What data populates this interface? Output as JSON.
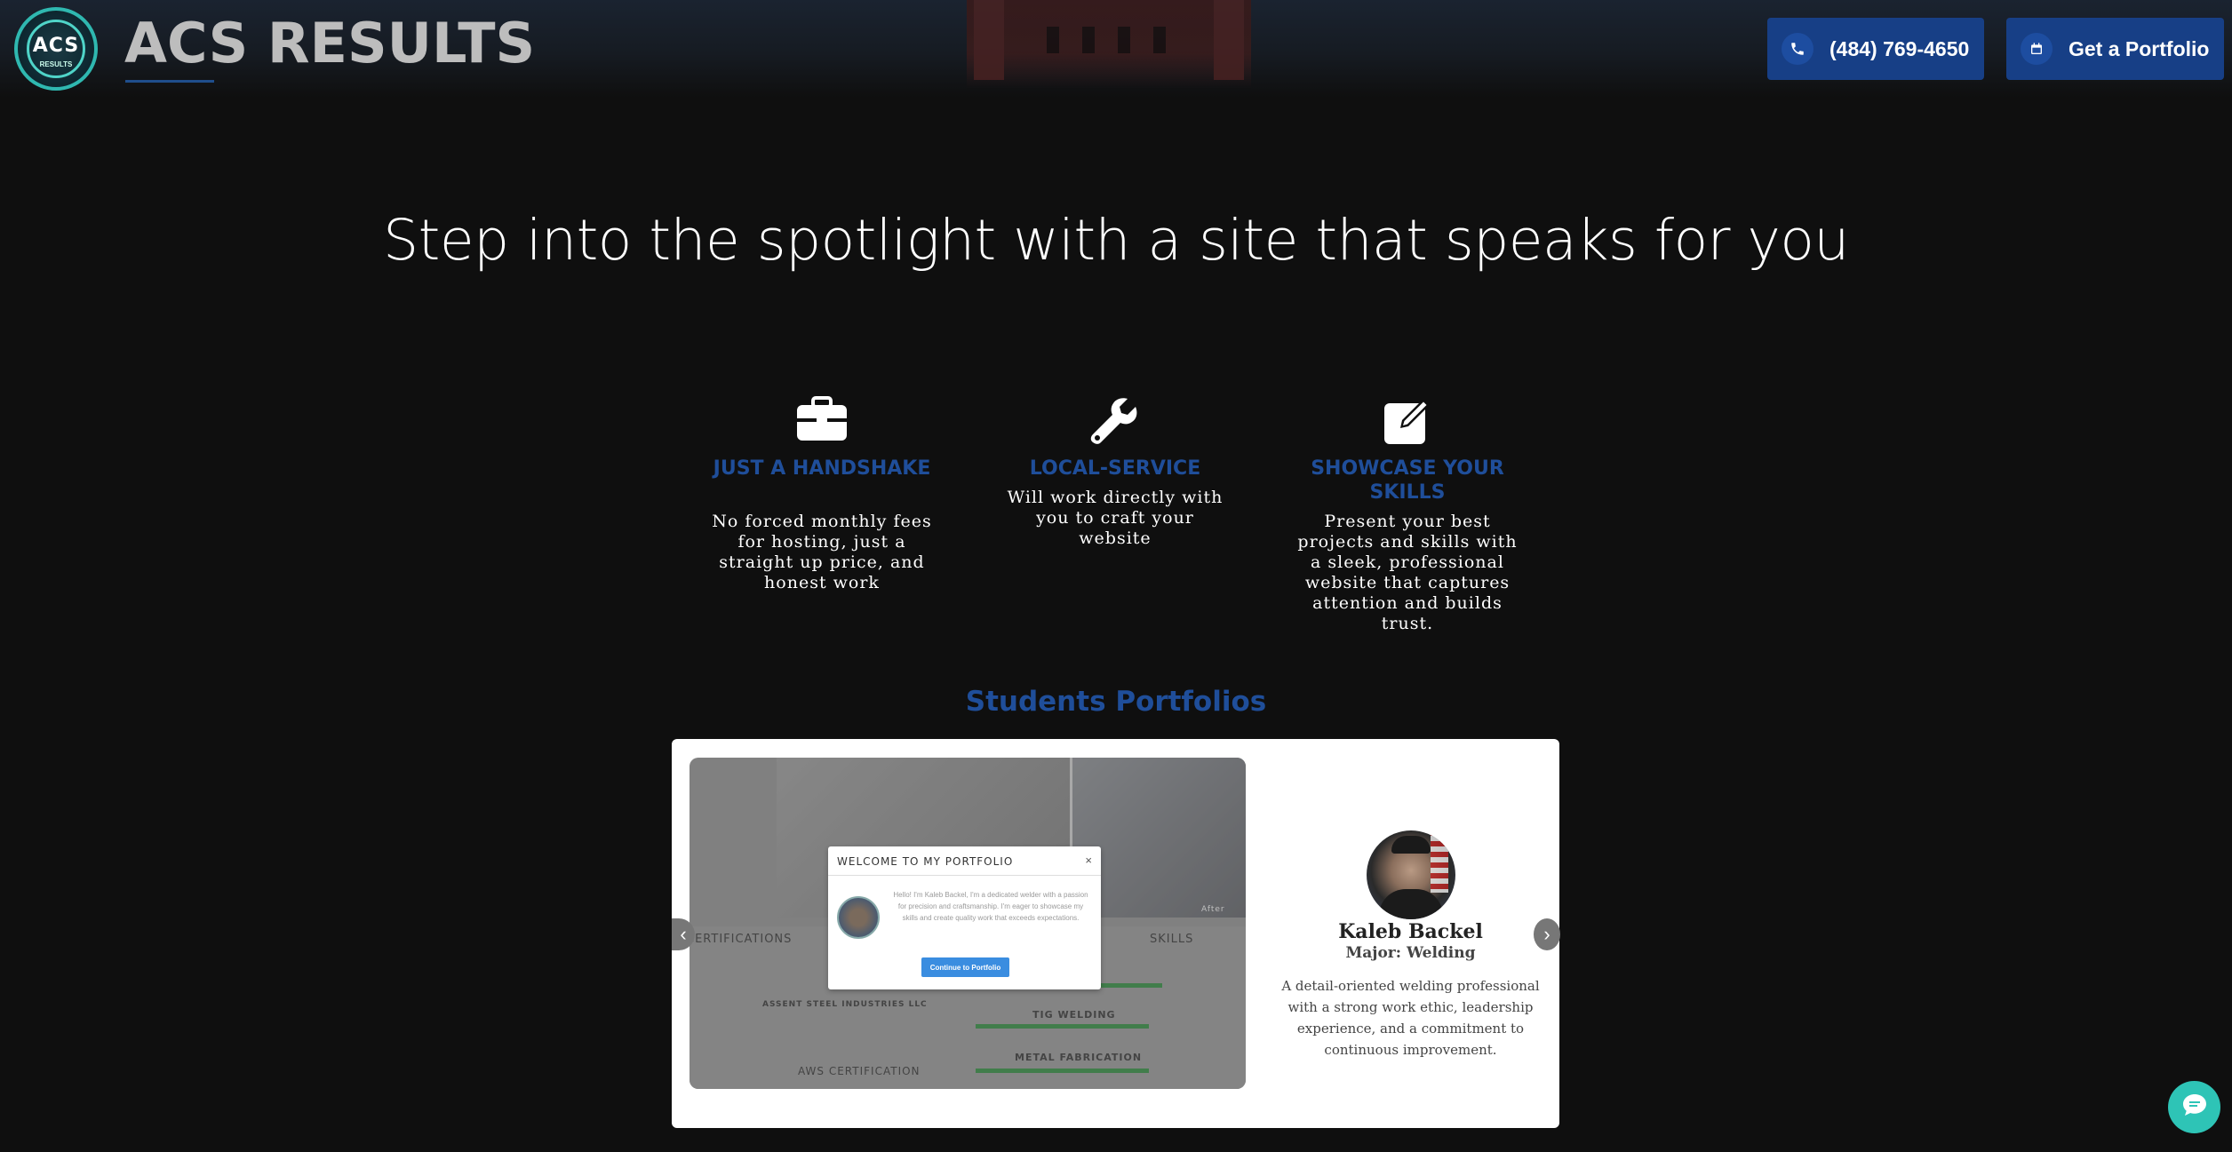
{
  "header": {
    "logo_text": "ACS",
    "logo_subtext": "RESULTS",
    "brand": "ACS RESULTS",
    "phone_label": "(484) 769-4650",
    "portfolio_label": "Get a Portfolio"
  },
  "hero": {
    "title": "Step into the spotlight with a site that speaks for you"
  },
  "features": [
    {
      "icon": "briefcase-icon",
      "title": "JUST A HANDSHAKE",
      "desc": "No forced monthly fees for hosting, just a straight up price, and honest work"
    },
    {
      "icon": "wrench-icon",
      "title": "LOCAL-SERVICE",
      "desc": "Will work directly with you to craft your website"
    },
    {
      "icon": "edit-icon",
      "title": "SHOWCASE YOUR SKILLS",
      "desc": "Present your best projects and skills with a sleek, professional website that captures attention and builds trust."
    }
  ],
  "portfolios": {
    "title": "Students Portfolios",
    "preview": {
      "modal_title": "WELCOME TO MY PORTFOLIO",
      "modal_close": "×",
      "modal_text": "Hello! I'm Kaleb Backel, I'm a dedicated welder with a passion for precision and craftsmanship. I'm eager to showcase my skills and create quality work that exceeds expectations.",
      "modal_button": "Continue to Portfolio",
      "certifications_label": "CERTIFICATIONS",
      "skills_label": "SKILLS",
      "company_label": "ASSENT STEEL INDUSTRIES LLC",
      "aws_label": "AWS CERTIFICATION",
      "tig_label": "TIG WELDING",
      "metal_label": "METAL FABRICATION",
      "after_label": "After"
    },
    "student": {
      "name": "Kaleb Backel",
      "major": "Major: Welding",
      "description": "A detail-oriented welding professional with a strong work ethic, leadership experience, and a commitment to continuous improvement."
    },
    "prev_arrow": "‹",
    "next_arrow": "›"
  },
  "colors": {
    "accent": "#1f4e9a",
    "button": "#173f86",
    "chat": "#2ec4b6"
  }
}
